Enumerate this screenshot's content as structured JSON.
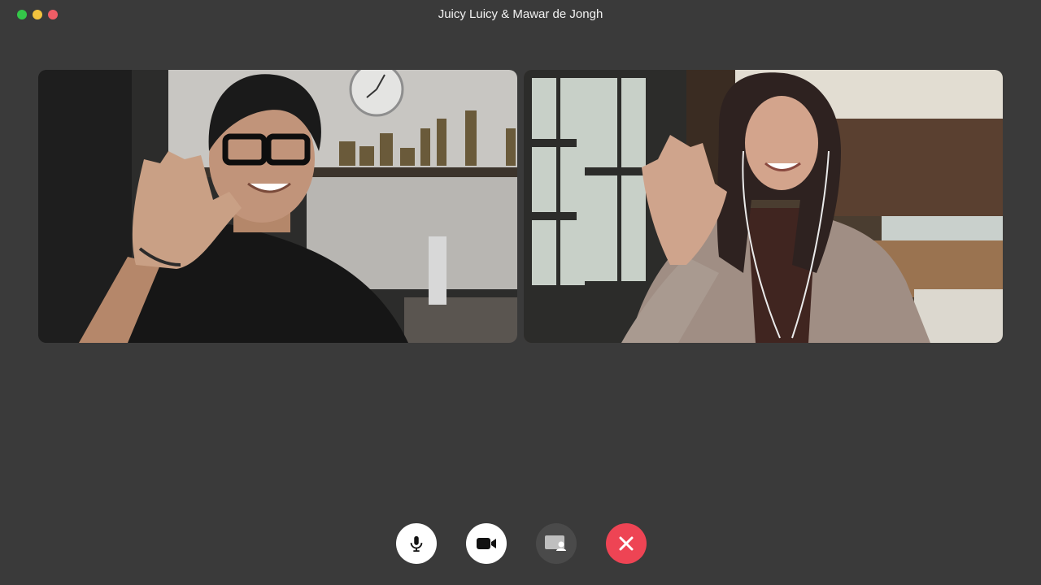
{
  "window": {
    "title": "Juicy Luicy & Mawar de Jongh",
    "buttons": [
      {
        "name": "window-close-dot",
        "color": "#34c749"
      },
      {
        "name": "window-minimize-dot",
        "color": "#f3c33e"
      },
      {
        "name": "window-zoom-dot",
        "color": "#ee5d66"
      }
    ]
  },
  "participants": [
    {
      "tile": "left",
      "scene": "man with black glasses waving in a kitchen"
    },
    {
      "tile": "right",
      "scene": "woman with earphones waving in a cafe"
    }
  ],
  "controls": [
    {
      "name": "microphone-button",
      "icon": "microphone-icon",
      "bg": "#ffffff"
    },
    {
      "name": "camera-button",
      "icon": "video-camera-icon",
      "bg": "#ffffff"
    },
    {
      "name": "share-screen-button",
      "icon": "share-screen-icon",
      "bg": "#4a4a4a"
    },
    {
      "name": "end-call-button",
      "icon": "close-icon",
      "bg": "#ee4454"
    }
  ]
}
